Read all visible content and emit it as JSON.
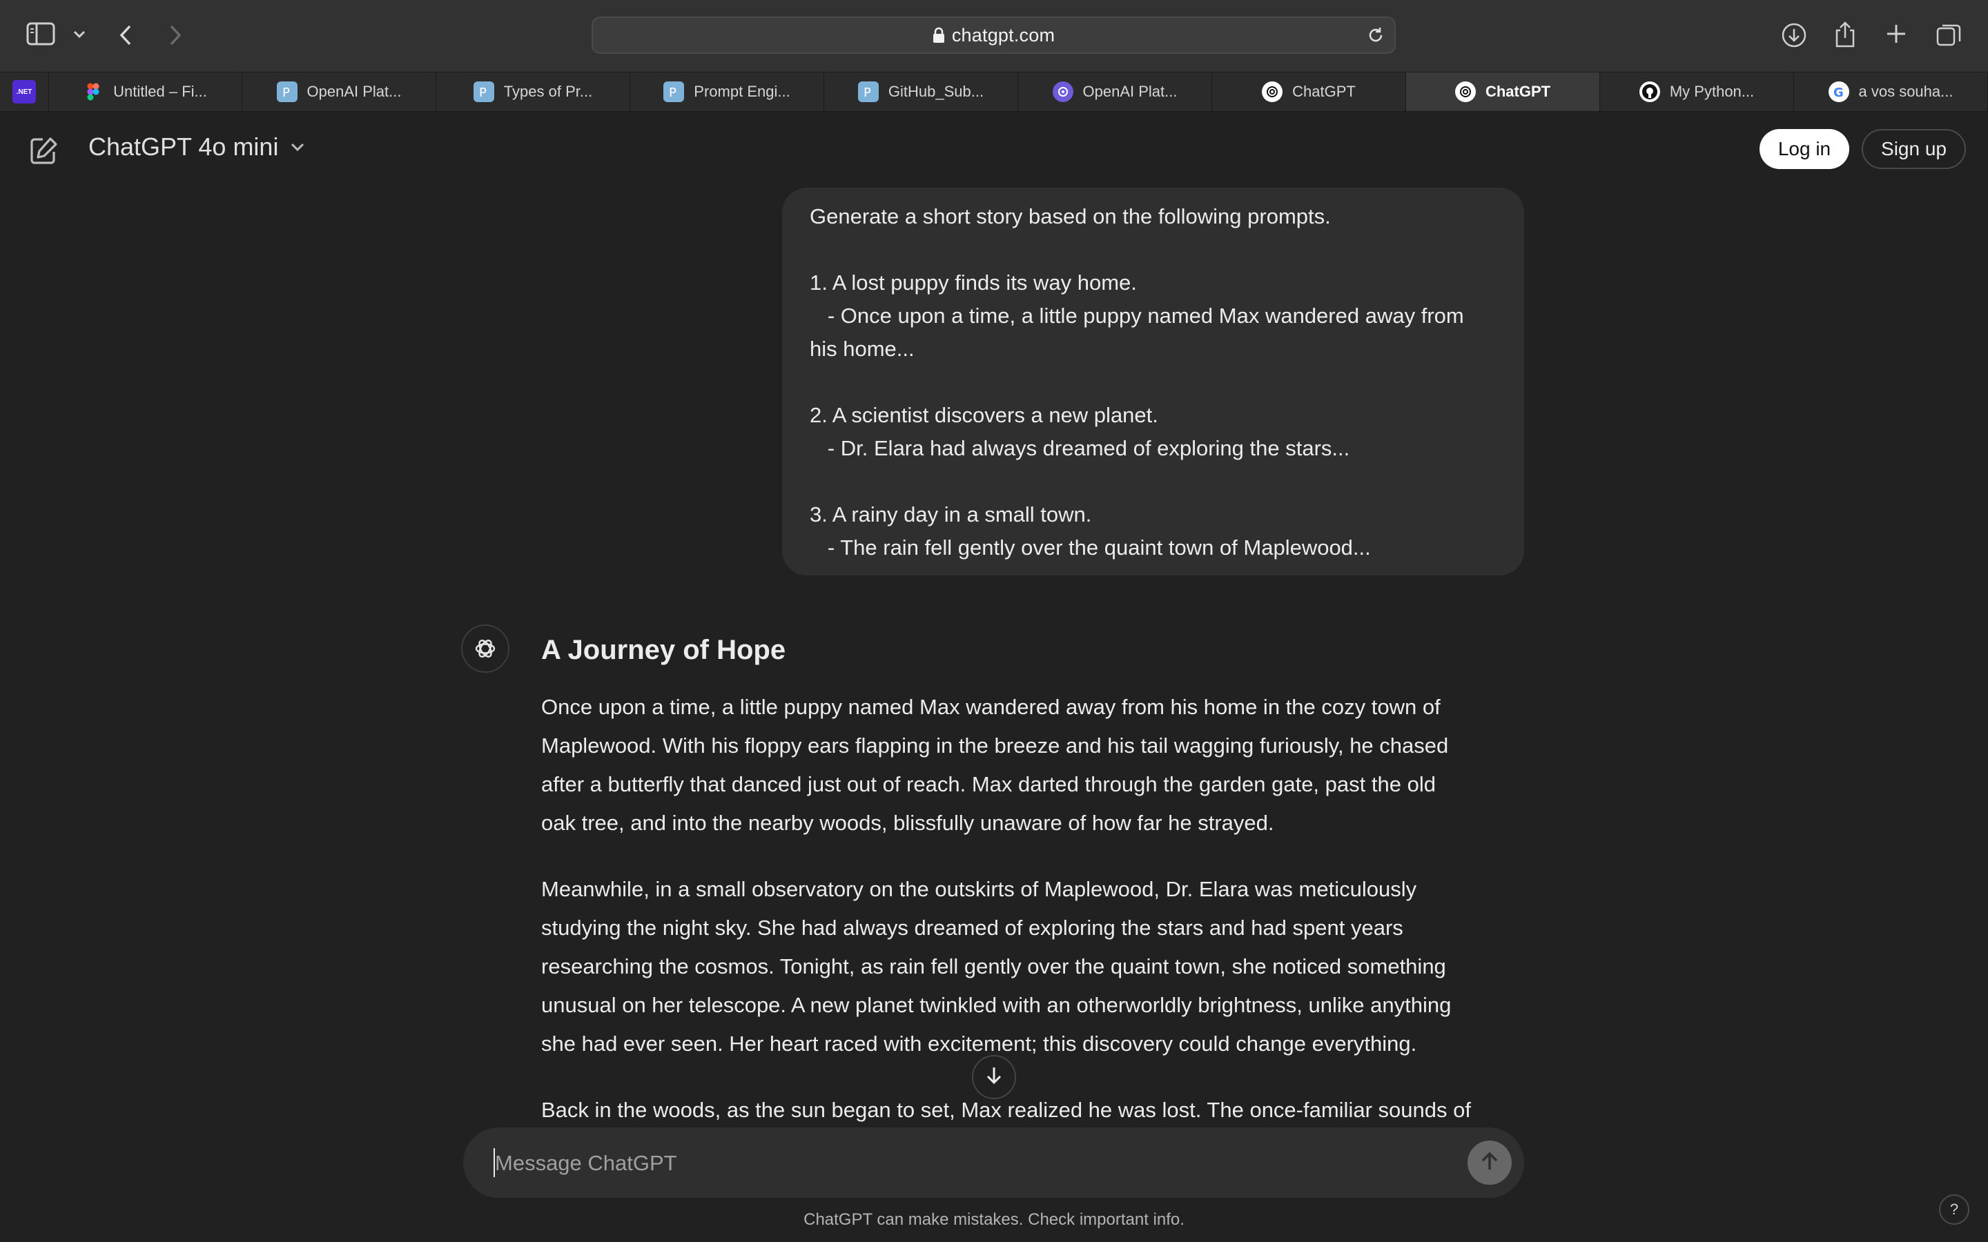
{
  "browser": {
    "url": "chatgpt.com",
    "pinned_tab_label": ".NET",
    "tabs": [
      {
        "label": "Untitled – Fi...",
        "icon": "figma-icon",
        "active": false
      },
      {
        "label": "OpenAI Plat...",
        "icon": "openai-platform-icon",
        "active": false
      },
      {
        "label": "Types of Pr...",
        "icon": "doc-icon",
        "active": false
      },
      {
        "label": "Prompt Engi...",
        "icon": "doc-icon",
        "active": false
      },
      {
        "label": "GitHub_Sub...",
        "icon": "doc-icon",
        "active": false
      },
      {
        "label": "OpenAI Plat...",
        "icon": "openai-icon",
        "active": false
      },
      {
        "label": "ChatGPT",
        "icon": "chatgpt-icon",
        "active": false
      },
      {
        "label": "ChatGPT",
        "icon": "chatgpt-icon",
        "active": true
      },
      {
        "label": "My Python...",
        "icon": "github-icon",
        "active": false
      },
      {
        "label": "a vos souha...",
        "icon": "google-icon",
        "active": false
      }
    ]
  },
  "header": {
    "model": "ChatGPT 4o mini",
    "login": "Log in",
    "signup": "Sign up"
  },
  "user_message": {
    "lines": [
      "Generate a short story based on the following prompts.",
      "",
      "1. A lost puppy finds its way home.",
      "   - Once upon a time, a little puppy named Max wandered away from his home...",
      "",
      "2. A scientist discovers a new planet.",
      "   - Dr. Elara had always dreamed of exploring the stars...",
      "",
      "3. A rainy day in a small town.",
      "   - The rain fell gently over the quaint town of Maplewood..."
    ]
  },
  "reply": {
    "title": "A Journey of Hope",
    "paragraphs": [
      [
        "Once upon a time, a little puppy named Max wandered away from his home in the cozy town of",
        "Maplewood. With his floppy ears flapping in the breeze and his tail wagging furiously, he chased",
        "after a butterfly that danced just out of reach. Max darted through the garden gate, past the old",
        "oak tree, and into the nearby woods, blissfully unaware of how far he strayed."
      ],
      [
        "Meanwhile, in a small observatory on the outskirts of Maplewood, Dr. Elara was meticulously",
        "studying the night sky. She had always dreamed of exploring the stars and had spent years",
        "researching the cosmos. Tonight, as rain fell gently over the quaint town, she noticed something",
        "unusual on her telescope. A new planet twinkled with an otherworldly brightness, unlike anything",
        "she had ever seen. Her heart raced with excitement; this discovery could change everything."
      ],
      [
        "Back in the woods, as the sun began to set, Max realized he was lost. The once-familiar sounds of"
      ]
    ]
  },
  "composer": {
    "placeholder": "Message ChatGPT"
  },
  "footer": {
    "disclaimer": "ChatGPT can make mistakes. Check important info.",
    "help": "?"
  },
  "colors": {
    "background": "#212121",
    "bubble": "#2f2f2f",
    "text": "#ececec",
    "toolbar": "#323232"
  }
}
